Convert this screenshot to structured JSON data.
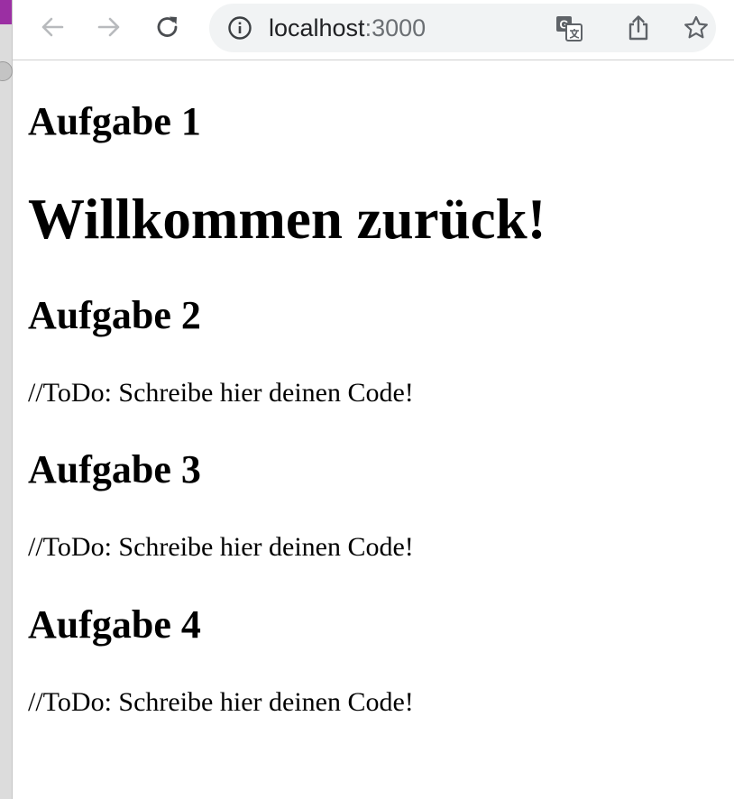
{
  "browser": {
    "url_host": "localhost",
    "url_port": ":3000",
    "icons": {
      "back": "arrow-left-icon",
      "forward": "arrow-right-icon",
      "reload": "reload-icon",
      "site_info": "info-icon",
      "translate": "translate-icon",
      "share": "share-icon",
      "bookmark": "star-icon"
    }
  },
  "page": {
    "task1_heading": "Aufgabe 1",
    "welcome": "Willkommen zurück!",
    "task2_heading": "Aufgabe 2",
    "task2_text": "//ToDo: Schreibe hier deinen Code!",
    "task3_heading": "Aufgabe 3",
    "task3_text": "//ToDo: Schreibe hier deinen Code!",
    "task4_heading": "Aufgabe 4",
    "task4_text": "//ToDo: Schreibe hier deinen Code!"
  }
}
